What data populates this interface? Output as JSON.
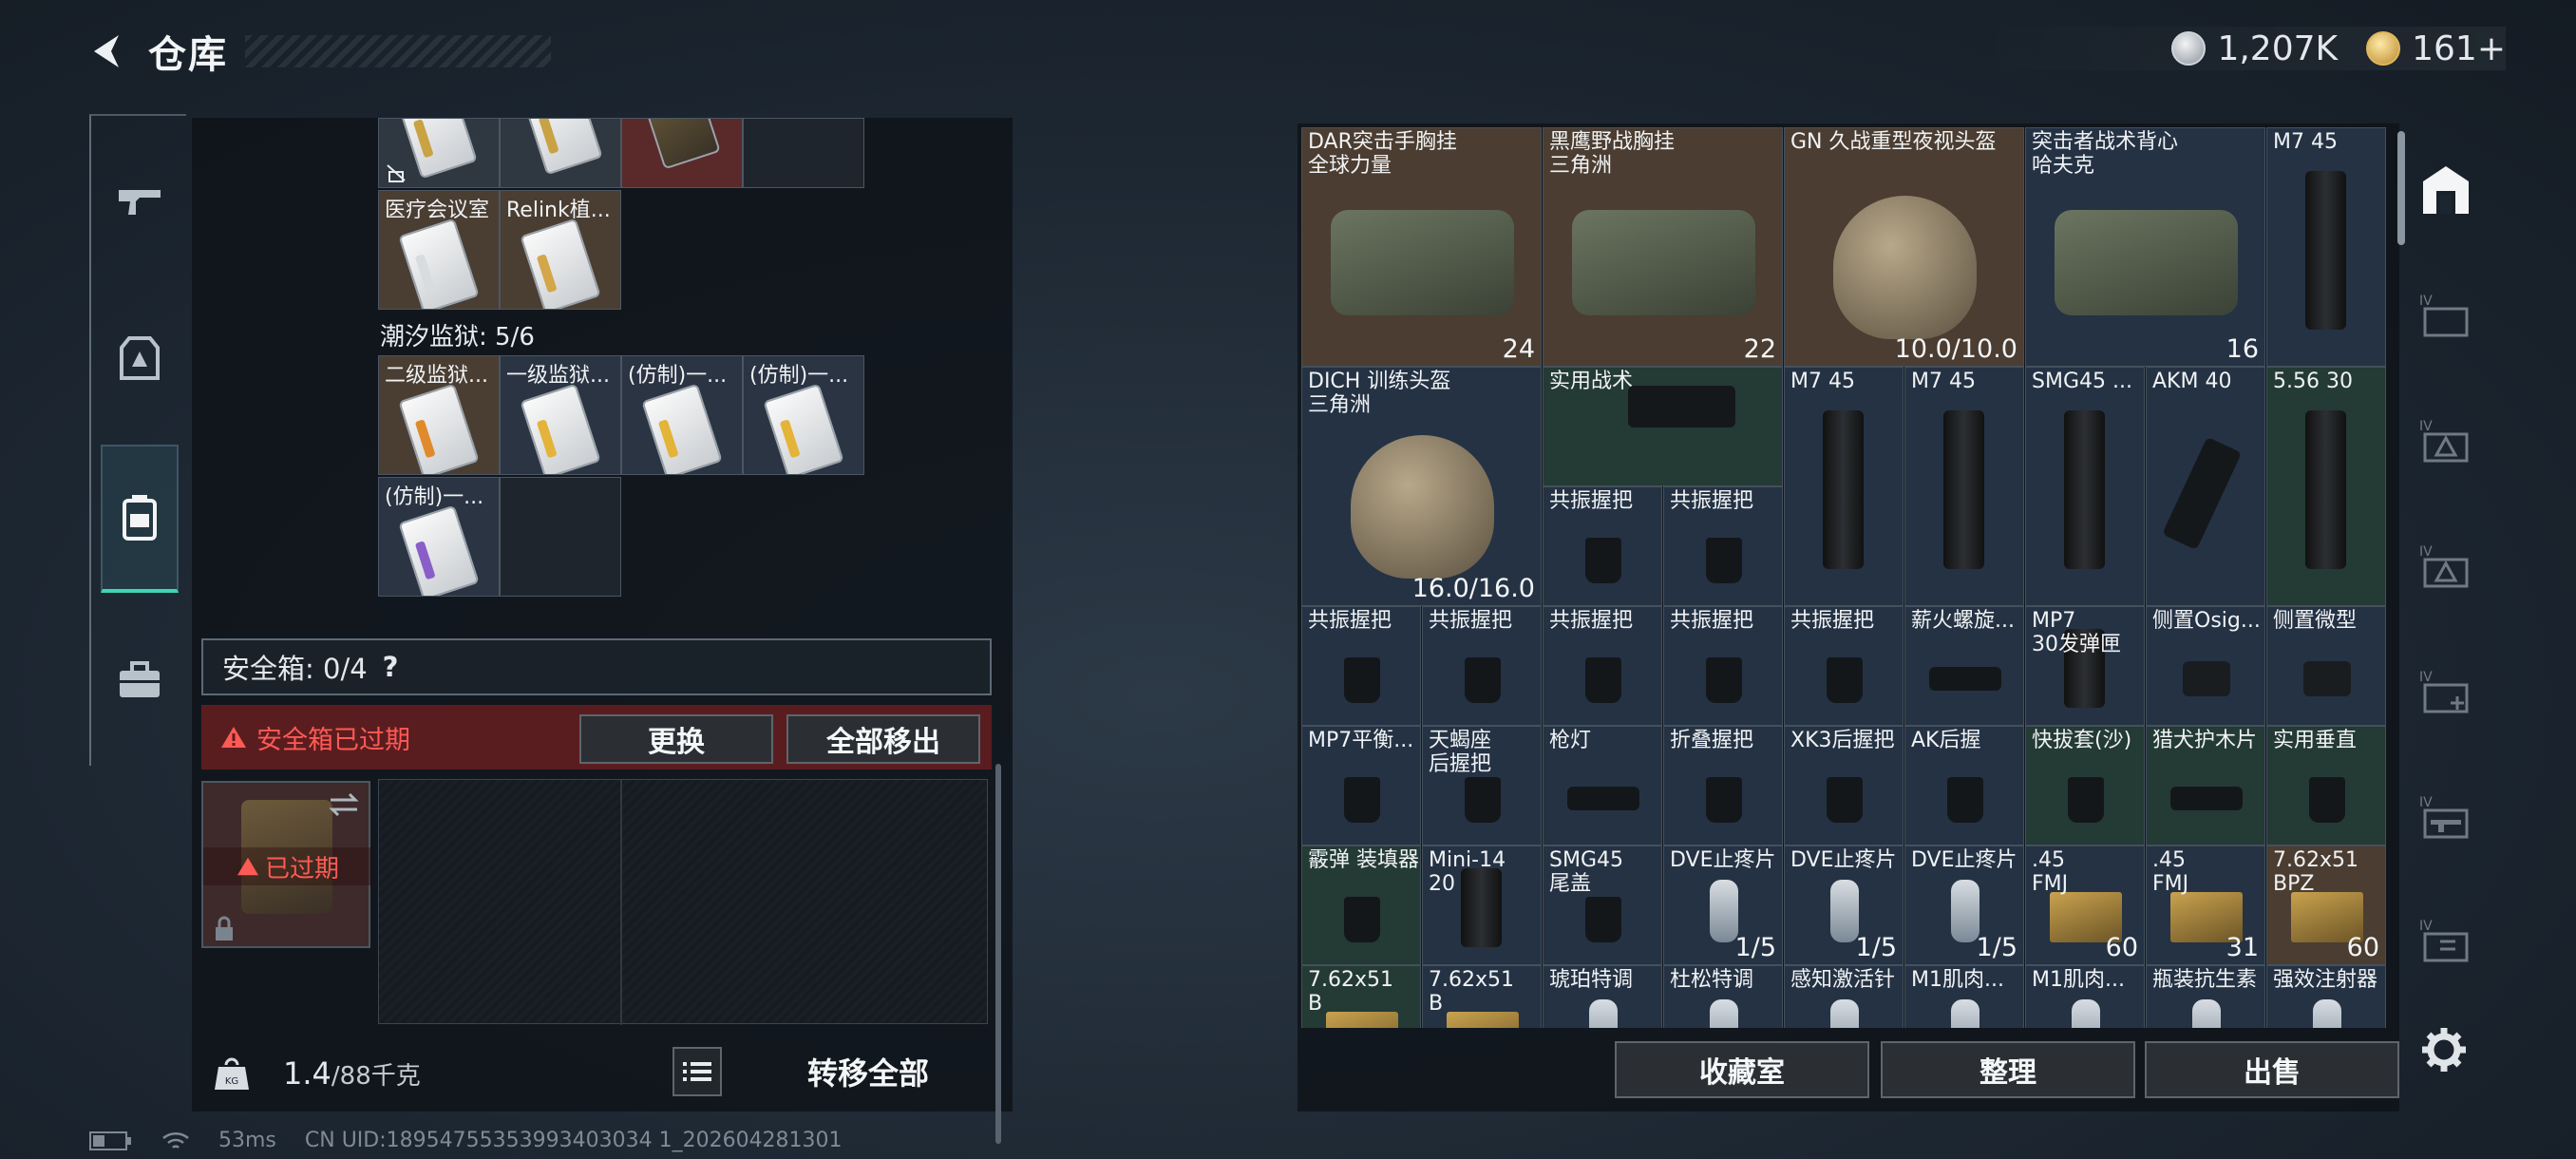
{
  "header": {
    "title": "仓库",
    "back_icon": "back-arrow-icon"
  },
  "currency": {
    "silver": "1,207K",
    "gold": "161+"
  },
  "sidenav": [
    "gun-icon",
    "armor-icon",
    "backpack-icon",
    "briefcase-icon"
  ],
  "left": {
    "top_cells": [
      {
        "label": "医疗会议室"
      },
      {
        "label": "Relink植..."
      }
    ],
    "prison_label": "潮汐监狱: 5/6",
    "prison_cells": [
      {
        "label": "二级监狱..."
      },
      {
        "label": "一级监狱..."
      },
      {
        "label": "(仿制)一..."
      },
      {
        "label": "(仿制)一..."
      },
      {
        "label": "(仿制)一..."
      }
    ],
    "safebox_label": "安全箱: 0/4",
    "help": "?",
    "expired_text": "安全箱已过期",
    "replace_btn": "更换",
    "moveall_btn": "全部移出",
    "expired_badge": "已过期",
    "weight_value": "1.4",
    "weight_cap": "/88千克",
    "transfer_btn": "转移全部"
  },
  "right": {
    "items": [
      {
        "label": "DAR突击手胸挂\n全球力量",
        "value": "24"
      },
      {
        "label": "黑鹰野战胸挂\n三角洲",
        "value": "22"
      },
      {
        "label": "GN 久战重型夜视头盔",
        "value": "10.0/10.0"
      },
      {
        "label": "突击者战术背心\n哈夫克",
        "value": "16"
      },
      {
        "label": "M7 45",
        "value": ""
      },
      {
        "label": "DICH 训练头盔\n三角洲",
        "value": "16.0/16.0"
      },
      {
        "label": "实用战术",
        "value": ""
      },
      {
        "label": "M7 45",
        "value": ""
      },
      {
        "label": "M7 45",
        "value": ""
      },
      {
        "label": "SMG45 ...",
        "value": ""
      },
      {
        "label": "AKM 40",
        "value": ""
      },
      {
        "label": "5.56 30",
        "value": ""
      },
      {
        "label": "共振握把",
        "value": ""
      },
      {
        "label": "共振握把",
        "value": ""
      },
      {
        "label": "共振握把",
        "value": ""
      },
      {
        "label": "共振握把",
        "value": ""
      },
      {
        "label": "共振握把",
        "value": ""
      },
      {
        "label": "共振握把",
        "value": ""
      },
      {
        "label": "共振握把",
        "value": ""
      },
      {
        "label": "薪火螺旋...",
        "value": ""
      },
      {
        "label": "MP7\n30发弹匣",
        "value": ""
      },
      {
        "label": "侧置Osig...",
        "value": ""
      },
      {
        "label": "侧置微型",
        "value": ""
      },
      {
        "label": "MP7平衡...",
        "value": ""
      },
      {
        "label": "天蝎座\n后握把",
        "value": ""
      },
      {
        "label": "枪灯",
        "value": ""
      },
      {
        "label": "折叠握把",
        "value": ""
      },
      {
        "label": "XK3后握把",
        "value": ""
      },
      {
        "label": "AK后握",
        "value": ""
      },
      {
        "label": "快拔套(沙)",
        "value": ""
      },
      {
        "label": "猎犬护木片",
        "value": ""
      },
      {
        "label": "实用垂直",
        "value": ""
      },
      {
        "label": "霰弹 装填器",
        "value": ""
      },
      {
        "label": "Mini-14\n20",
        "value": ""
      },
      {
        "label": "SMG45\n尾盖",
        "value": ""
      },
      {
        "label": "DVE止疼片",
        "value": "1/5"
      },
      {
        "label": "DVE止疼片",
        "value": "1/5"
      },
      {
        "label": "DVE止疼片",
        "value": "1/5"
      },
      {
        "label": ".45\nFMJ",
        "value": "60"
      },
      {
        "label": ".45\nFMJ",
        "value": "31"
      },
      {
        "label": "7.62x51\nBPZ",
        "value": "60"
      },
      {
        "label": "7.62x51\nB",
        "value": ""
      },
      {
        "label": "7.62x51\nB",
        "value": ""
      },
      {
        "label": "琥珀特调",
        "value": ""
      },
      {
        "label": "杜松特调",
        "value": ""
      },
      {
        "label": "感知激活针",
        "value": ""
      },
      {
        "label": "M1肌肉...",
        "value": ""
      },
      {
        "label": "M1肌肉...",
        "value": ""
      },
      {
        "label": "瓶装抗生素",
        "value": ""
      },
      {
        "label": "强效注射器",
        "value": ""
      }
    ],
    "buttons": {
      "collect": "收藏室",
      "sort": "整理",
      "sell": "出售"
    }
  },
  "status": {
    "ping": "53ms",
    "uid": "CN UID:18954755353993403034 1_202604281301"
  }
}
